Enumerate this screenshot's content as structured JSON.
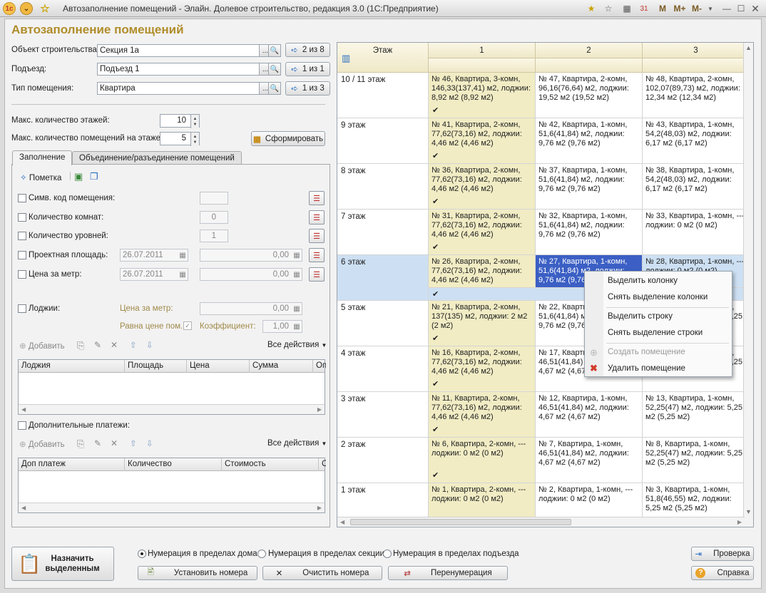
{
  "titlebar": {
    "title": "Автозаполнение помещений - Элайн. Долевое строительство, редакция 3.0  (1С:Предприятие)",
    "tools": [
      "M",
      "M+",
      "M-"
    ]
  },
  "page_title": "Автозаполнение помещений",
  "object": {
    "label": "Объект строительства:",
    "value": "Секция 1а",
    "pager": "2 из 8"
  },
  "entrance": {
    "label": "Подъезд:",
    "value": "Подъезд 1",
    "pager": "1 из 1"
  },
  "room_type": {
    "label": "Тип помещения:",
    "value": "Квартира",
    "pager": "1 из 3"
  },
  "max_floors": {
    "label": "Макс. количество этажей:",
    "value": "10"
  },
  "max_rooms": {
    "label": "Макс. количество помещений на этаже:",
    "value": "5"
  },
  "generate_button": "Сформировать",
  "tabs": [
    {
      "label": "Заполнение",
      "active": true
    },
    {
      "label": "Объединение/разъединение помещений",
      "active": false
    }
  ],
  "fill_tab": {
    "mark_button": "Пометка",
    "symbol_code": {
      "label": "Симв. код помещения:",
      "value": ""
    },
    "rooms_count": {
      "label": "Количество комнат:",
      "value": "0"
    },
    "levels_count": {
      "label": "Количество уровней:",
      "value": "1"
    },
    "project_area": {
      "label": "Проектная площадь:",
      "date": "26.07.2011",
      "value": "0,00"
    },
    "price_per_meter": {
      "label": "Цена за метр:",
      "date": "26.07.2011",
      "value": "0,00"
    },
    "loggias": {
      "label": "Лоджии:",
      "price_label": "Цена за метр:",
      "price_value": "0,00",
      "equal_label": "Равна цене пом.:",
      "coef_label": "Коэффициент:",
      "coef_value": "1,00"
    },
    "add_button": "Добавить",
    "all_actions": "Все действия",
    "loggia_table": {
      "columns": [
        "Лоджия",
        "Площадь",
        "Цена",
        "Сумма",
        "Оп"
      ]
    },
    "extra_payments": {
      "label": "Дополнительные платежи:"
    },
    "extra_table": {
      "columns": [
        "Доп платеж",
        "Количество",
        "Стоимость",
        "С"
      ]
    }
  },
  "grid": {
    "floor_header": "Этаж",
    "columns": [
      "1",
      "2",
      "3"
    ],
    "rows": [
      {
        "floor": "10 / 11 этаж",
        "cells": [
          [
            "№ 46, Квартира, 3-комн,",
            "146,33(137,41)  м2, лоджии:",
            "8,92 м2  (8,92 м2)"
          ],
          [
            "№ 47, Квартира, 2-комн,",
            "96,16(76,64)  м2, лоджии:",
            "19,52 м2  (19,52 м2)"
          ],
          [
            "№ 48, Квартира, 2-комн,",
            "102,07(89,73)  м2, лоджии:",
            "12,34 м2  (12,34 м2)"
          ]
        ],
        "tick": true
      },
      {
        "floor": "9 этаж",
        "cells": [
          [
            "№ 41, Квартира, 2-комн,",
            "77,62(73,16)  м2, лоджии:",
            "4,46 м2  (4,46 м2)"
          ],
          [
            "№ 42, Квартира, 1-комн,",
            "51,6(41,84)  м2, лоджии:",
            "9,76 м2  (9,76 м2)"
          ],
          [
            "№ 43, Квартира, 1-комн,",
            "54,2(48,03)  м2, лоджии:",
            "6,17 м2  (6,17 м2)"
          ]
        ],
        "tick": true
      },
      {
        "floor": "8 этаж",
        "cells": [
          [
            "№ 36, Квартира, 2-комн,",
            "77,62(73,16)  м2, лоджии:",
            "4,46 м2  (4,46 м2)"
          ],
          [
            "№ 37, Квартира, 1-комн,",
            "51,6(41,84)  м2, лоджии:",
            "9,76 м2  (9,76 м2)"
          ],
          [
            "№ 38, Квартира, 1-комн,",
            "54,2(48,03)  м2, лоджии:",
            "6,17 м2  (6,17 м2)"
          ]
        ],
        "tick": true
      },
      {
        "floor": "7 этаж",
        "cells": [
          [
            "№ 31, Квартира, 2-комн,",
            "77,62(73,16)  м2, лоджии:",
            "4,46 м2  (4,46 м2)"
          ],
          [
            "№ 32, Квартира, 1-комн,",
            "51,6(41,84)  м2, лоджии:",
            "9,76 м2  (9,76 м2)"
          ],
          [
            "№ 33, Квартира, 1-комн, ---",
            "лоджии: 0 м2  (0 м2)",
            ""
          ]
        ],
        "tick": true
      },
      {
        "floor": "6 этаж",
        "cells": [
          [
            "№ 26, Квартира, 2-комн,",
            "77,62(73,16)  м2, лоджии:",
            "4,46 м2  (4,46 м2)"
          ],
          [
            "№ 27, Квартира, 1-комн,",
            "51,6(41,84)  м2, лоджии:",
            "9,76 м2  (9,76 м2)"
          ],
          [
            "№ 28, Квартира, 1-комн, ---",
            "лоджии: 0 м2  (0 м2)",
            ""
          ]
        ],
        "tick": true,
        "selected": true
      },
      {
        "floor": "5 этаж",
        "cells": [
          [
            "№ 21, Квартира, 2-комн,",
            "137(135)  м2, лоджии: 2 м2",
            "(2 м2)"
          ],
          [
            "№ 22, Квартира, 1-комн,",
            "51,6(41,84)  м2, лоджии:",
            "9,76 м2  (9,76 м2)"
          ],
          [
            "№ 23, Квартира, 1-комн,",
            "52,25(47)  м2, лоджии: 5,25",
            "м2  (5,25 м2)"
          ]
        ],
        "tick": true
      },
      {
        "floor": "4 этаж",
        "cells": [
          [
            "№ 16, Квартира, 2-комн,",
            "77,62(73,16)  м2, лоджии:",
            "4,46 м2  (4,46 м2)"
          ],
          [
            "№ 17, Квартира, 1-комн,",
            "46,51(41,84)  м2, лоджии:",
            "4,67 м2  (4,67 м2)"
          ],
          [
            "№ 18, Квартира, 1-комн,",
            "52,25(47)  м2, лоджии: 5,25",
            "м2  (5,25 м2)"
          ]
        ],
        "tick": true
      },
      {
        "floor": "3 этаж",
        "cells": [
          [
            "№ 11, Квартира, 2-комн,",
            "77,62(73,16)  м2, лоджии:",
            "4,46 м2  (4,46 м2)"
          ],
          [
            "№ 12, Квартира, 1-комн,",
            "46,51(41,84)  м2, лоджии:",
            "4,67 м2  (4,67 м2)"
          ],
          [
            "№ 13, Квартира, 1-комн,",
            "52,25(47)  м2, лоджии: 5,25",
            "м2  (5,25 м2)"
          ]
        ],
        "tick": true
      },
      {
        "floor": "2 этаж",
        "cells": [
          [
            "№ 6, Квартира, 2-комн, ---",
            "лоджии: 0 м2  (0 м2)",
            ""
          ],
          [
            "№ 7, Квартира, 1-комн,",
            "46,51(41,84)  м2, лоджии:",
            "4,67 м2  (4,67 м2)"
          ],
          [
            "№ 8, Квартира, 1-комн,",
            "52,25(47)  м2, лоджии: 5,25",
            "м2  (5,25 м2)"
          ]
        ],
        "tick": true
      },
      {
        "floor": "1 этаж",
        "cells": [
          [
            "№ 1, Квартира, 2-комн, ---",
            "лоджии: 0 м2  (0 м2)",
            ""
          ],
          [
            "№ 2, Квартира, 1-комн, ---",
            "лоджии: 0 м2  (0 м2)",
            ""
          ],
          [
            "№ 3, Квартира, 1-комн,",
            "51,8(46,55)  м2, лоджии:",
            "5,25 м2  (5,25 м2)"
          ]
        ],
        "tick": false
      }
    ]
  },
  "context_menu": {
    "items": [
      "Выделить колонку",
      "Снять выделение колонки",
      "Выделить строку",
      "Снять выделение строки",
      "Создать помещение",
      "Удалить помещение"
    ]
  },
  "bottom": {
    "assign_button": [
      "Назначить",
      "выделенным"
    ],
    "radios": [
      {
        "label": "Нумерация в пределах дома",
        "checked": true
      },
      {
        "label": "Нумерация в пределах секции",
        "checked": false
      },
      {
        "label": "Нумерация в пределах подъезда",
        "checked": false
      }
    ],
    "set_numbers": "Установить номера",
    "clear_numbers": "Очистить номера",
    "renumber": "Перенумерация",
    "check": "Проверка",
    "help": "Справка"
  }
}
